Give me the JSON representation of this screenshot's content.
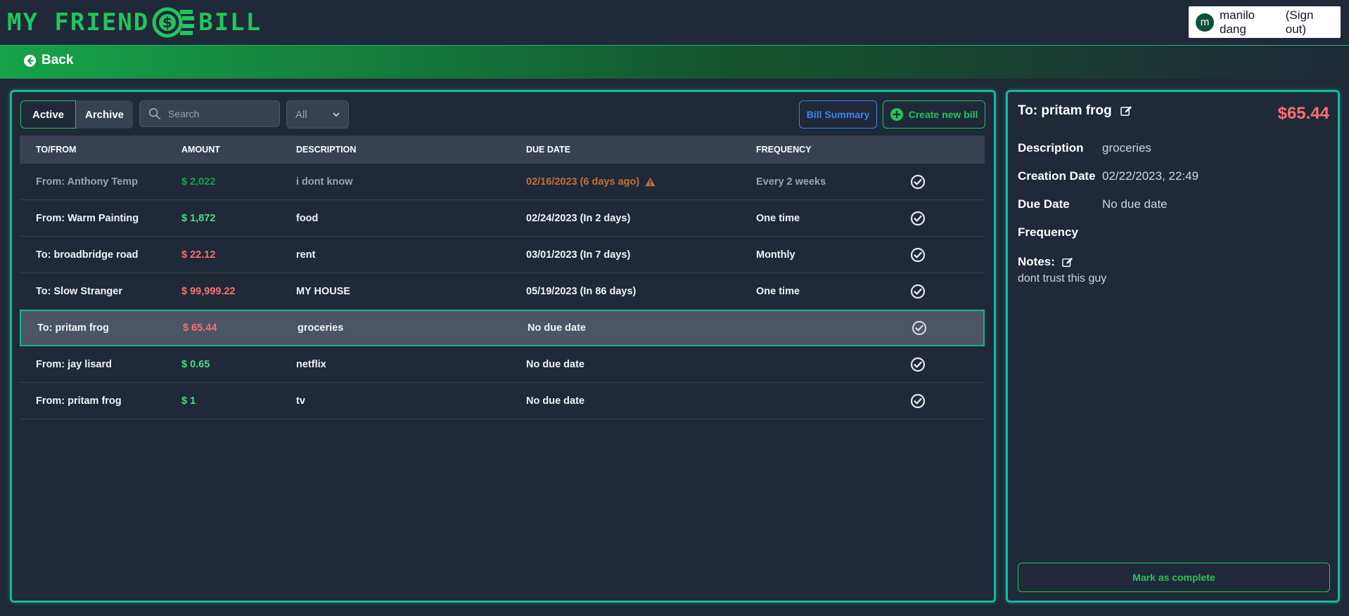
{
  "app": {
    "logo_left": "MY FRIEND",
    "logo_right": "BILL",
    "colors": {
      "brand": "#22c55e",
      "accent_teal": "#14b8a6",
      "negative": "#f87171",
      "positive": "#4ade80",
      "link_blue": "#3b82f6"
    }
  },
  "user": {
    "initial": "m",
    "name": "manilo dang",
    "sign_out": "(Sign out)"
  },
  "nav": {
    "back_label": "Back"
  },
  "toolbar": {
    "tab_active": "Active",
    "tab_archive": "Archive",
    "search_placeholder": "Search",
    "filter_value": "All",
    "summary_label": "Bill Summary",
    "create_label": "Create new bill"
  },
  "table": {
    "headers": [
      "TO/FROM",
      "AMOUNT",
      "DESCRIPTION",
      "DUE DATE",
      "FREQUENCY"
    ],
    "rows": [
      {
        "party": "From: Anthony Temp",
        "amount": "$ 2,022",
        "description": "i dont know",
        "due": "02/16/2023 (6 days ago)",
        "frequency": "Every 2 weeks"
      },
      {
        "party": "From: Warm Painting",
        "amount": "$ 1,872",
        "description": "food",
        "due": "02/24/2023 (In 2 days)",
        "frequency": "One time"
      },
      {
        "party": "To: broadbridge road",
        "amount": "$ 22.12",
        "description": "rent",
        "due": "03/01/2023 (In 7 days)",
        "frequency": "Monthly"
      },
      {
        "party": "To: Slow Stranger",
        "amount": "$ 99,999.22",
        "description": "MY HOUSE",
        "due": "05/19/2023 (In 86 days)",
        "frequency": "One time"
      },
      {
        "party": "To: pritam frog",
        "amount": "$ 65.44",
        "description": "groceries",
        "due": "No due date",
        "frequency": ""
      },
      {
        "party": "From: jay lisard",
        "amount": "$ 0.65",
        "description": "netflix",
        "due": "No due date",
        "frequency": ""
      },
      {
        "party": "From: pritam frog",
        "amount": "$ 1",
        "description": "tv",
        "due": "No due date",
        "frequency": ""
      }
    ]
  },
  "detail": {
    "title": "To: pritam frog",
    "amount": "$65.44",
    "description_label": "Description",
    "description_value": "groceries",
    "creation_label": "Creation Date",
    "creation_value": "02/22/2023, 22:49",
    "due_label": "Due Date",
    "due_value": "No due date",
    "frequency_label": "Frequency",
    "frequency_value": "",
    "notes_label": "Notes:",
    "notes_text": "dont trust this guy",
    "complete_label": "Mark as complete"
  }
}
